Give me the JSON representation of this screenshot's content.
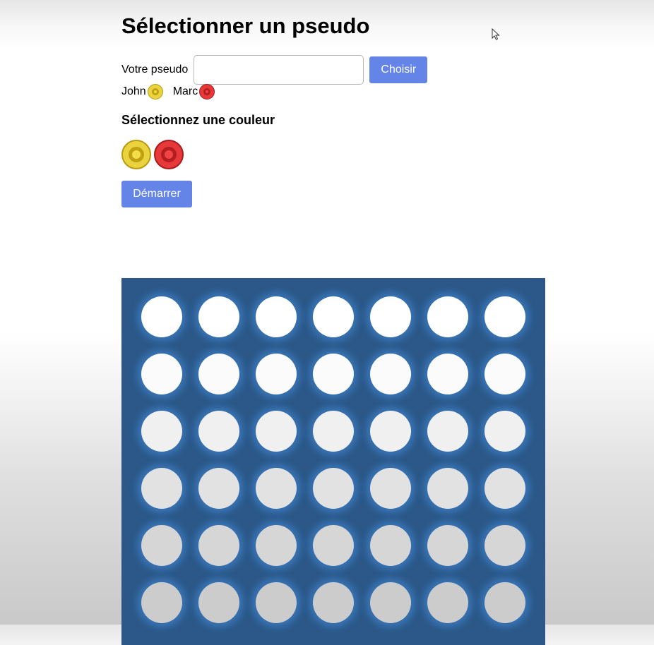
{
  "page_title": "Sélectionner un pseudo",
  "pseudo": {
    "label": "Votre pseudo",
    "value": "",
    "placeholder": "",
    "button_label": "Choisir"
  },
  "players": [
    {
      "name": "John",
      "color": "yellow"
    },
    {
      "name": "Marc",
      "color": "red"
    }
  ],
  "color_section_title": "Sélectionnez une couleur",
  "color_options": [
    "yellow",
    "red"
  ],
  "start_button_label": "Démarrer",
  "board": {
    "columns": 7,
    "rows": 6,
    "cells": "all empty"
  },
  "colors": {
    "accent_button": "#6484e8",
    "board": "#2b5888",
    "yellow_token": "#ebd23f",
    "red_token": "#e8393a"
  }
}
